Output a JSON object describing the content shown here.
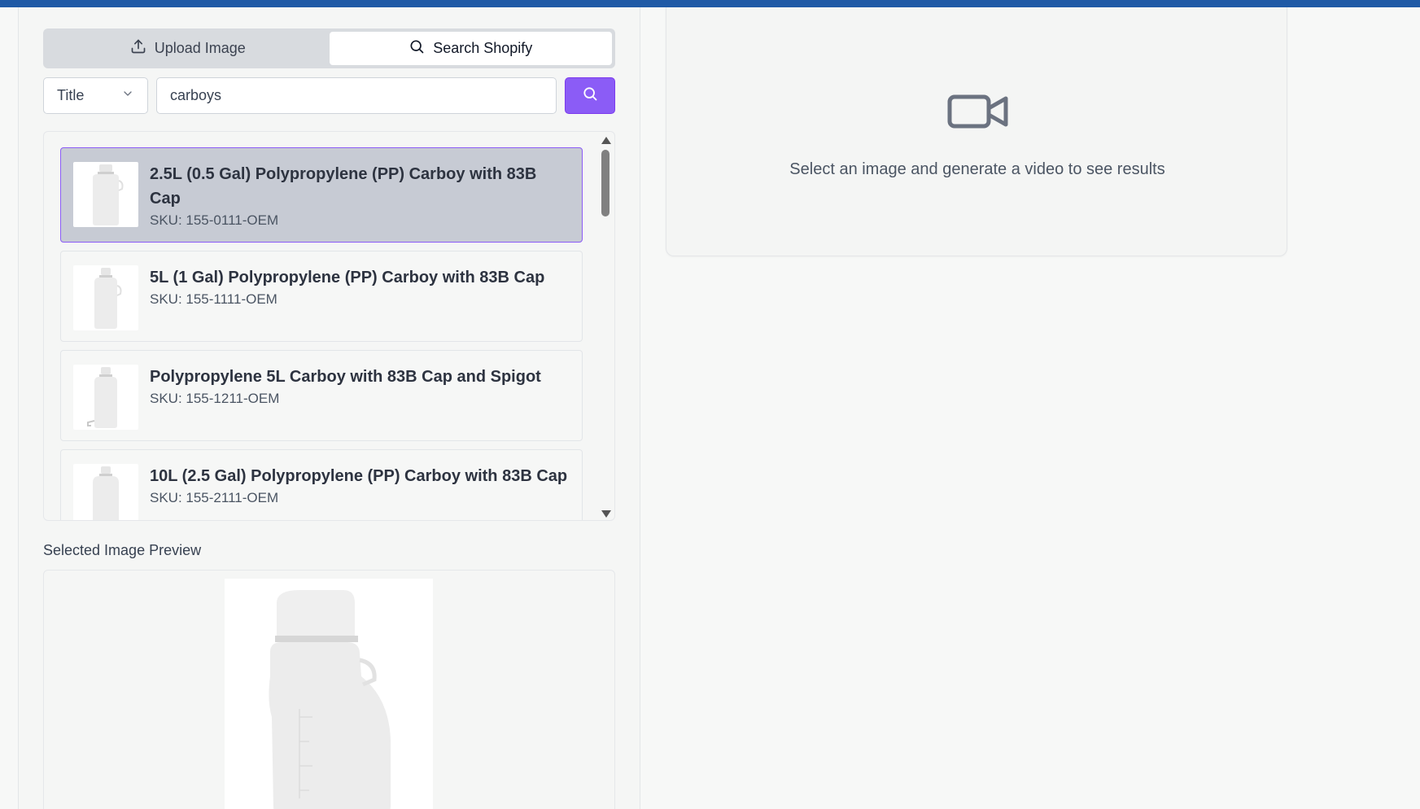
{
  "tabs": {
    "upload_label": "Upload Image",
    "search_label": "Search Shopify",
    "active": "Search Shopify"
  },
  "search": {
    "field_select": "Title",
    "query": "carboys",
    "button_icon": "search-icon"
  },
  "results": [
    {
      "title": "2.5L (0.5 Gal) Polypropylene (PP) Carboy with 83B Cap",
      "sku": "SKU: 155-0111-OEM",
      "selected": true
    },
    {
      "title": "5L (1 Gal) Polypropylene (PP) Carboy with 83B Cap",
      "sku": "SKU: 155-1111-OEM",
      "selected": false
    },
    {
      "title": "Polypropylene 5L Carboy with 83B Cap and Spigot",
      "sku": "SKU: 155-1211-OEM",
      "selected": false
    },
    {
      "title": "10L (2.5 Gal) Polypropylene (PP) Carboy with 83B Cap",
      "sku": "SKU: 155-2111-OEM",
      "selected": false
    }
  ],
  "preview": {
    "label": "Selected Image Preview"
  },
  "output": {
    "icon": "video-camera-icon",
    "placeholder": "Select an image and generate a video to see results"
  },
  "colors": {
    "accent": "#8b5cf6",
    "topbar": "#1f5aa6",
    "selected_bg": "#c7cbd4"
  }
}
